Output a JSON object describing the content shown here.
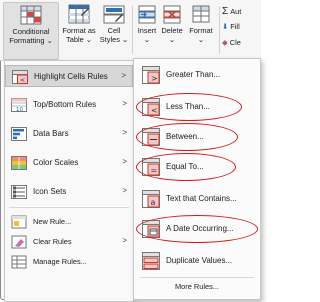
{
  "ribbon": {
    "conditional_formatting": [
      "Conditional",
      "Formatting"
    ],
    "format_as_table": [
      "Format as",
      "Table"
    ],
    "cell_styles": [
      "Cell",
      "Styles"
    ],
    "insert": "Insert",
    "delete": "Delete",
    "format": "Format",
    "autosum_partial": "Aut",
    "fill_partial": "Fill",
    "clear_partial": "Cle"
  },
  "menu": {
    "items": [
      {
        "label": "Highlight Cells Rules",
        "underline": "H",
        "has_submenu": true,
        "active": true
      },
      {
        "label": "Top/Bottom Rules",
        "underline": "T",
        "has_submenu": true
      },
      {
        "label": "Data Bars",
        "underline": "D",
        "has_submenu": true
      },
      {
        "label": "Color Scales",
        "underline": "S",
        "has_submenu": true
      },
      {
        "label": "Icon Sets",
        "underline": "I",
        "has_submenu": true
      }
    ],
    "actions": [
      {
        "label": "New Rule...",
        "underline": "N"
      },
      {
        "label": "Clear Rules",
        "underline": "C",
        "has_submenu": true
      },
      {
        "label": "Manage Rules...",
        "underline": "R"
      }
    ]
  },
  "submenu": {
    "items": [
      {
        "label": "Greater Than...",
        "underline": "G",
        "circled": false
      },
      {
        "label": "Less Than...",
        "underline": "L",
        "circled": true
      },
      {
        "label": "Between...",
        "underline": "B",
        "circled": true
      },
      {
        "label": "Equal To...",
        "underline": "E",
        "circled": true
      },
      {
        "label": "Text that Contains...",
        "underline": "T",
        "circled": false
      },
      {
        "label": "A Date Occurring...",
        "underline": "A",
        "circled": true
      },
      {
        "label": "Duplicate Values...",
        "underline": "D",
        "circled": false
      }
    ],
    "more_rules": "More Rules..."
  },
  "colors": {
    "highlight_oval": "#d21b1b",
    "active_bg": "#d7d7d7",
    "icon_red": "#c0392b",
    "icon_blue": "#2f6db5",
    "icon_green": "#3d9a46",
    "icon_yellow": "#f2c230"
  },
  "icons": [
    "conditional-formatting-icon",
    "format-as-table-icon",
    "cell-styles-icon",
    "insert-icon",
    "delete-icon",
    "format-icon",
    "autosum-icon",
    "fill-icon",
    "clear-icon",
    "chevron-right-icon"
  ]
}
